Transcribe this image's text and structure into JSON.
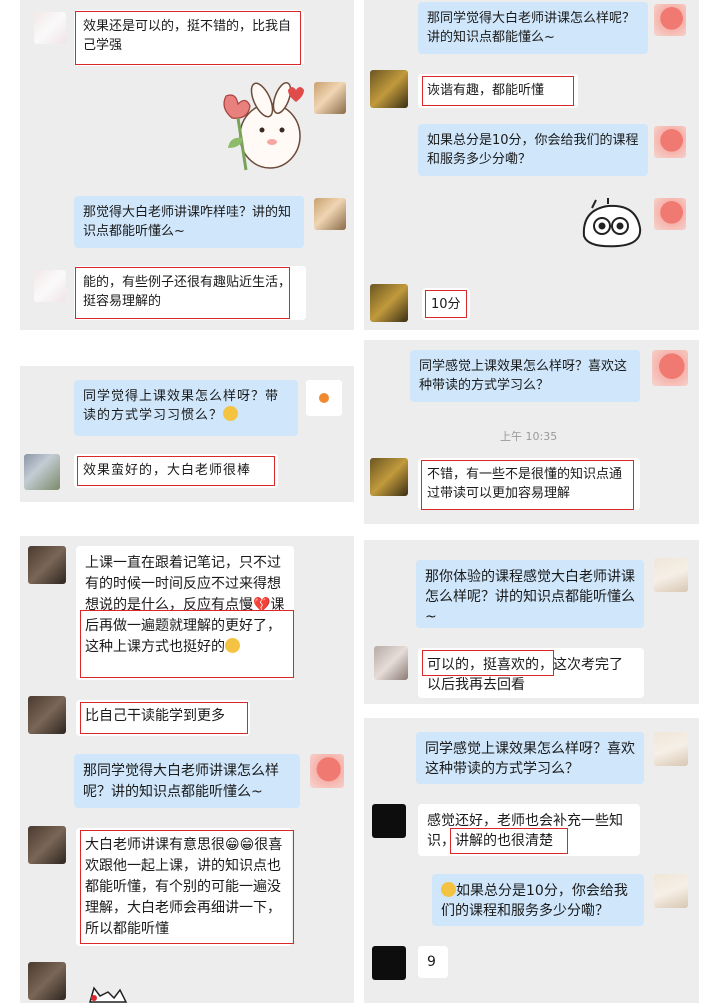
{
  "panel1": {
    "msg1": "效果还是可以的，挺不错的，比我自己学强",
    "msg2": "那觉得大白老师讲课咋样哇？讲的知识点都能听懂么~",
    "msg3": "能的，有些例子还很有趣贴近生活，挺容易理解的"
  },
  "panel2": {
    "msg1": "那同学觉得大白老师讲课怎么样呢？讲的知识点都能懂么~",
    "msg2": "诙谐有趣，都能听懂",
    "msg3": "如果总分是10分，你会给我们的课程和服务多少分嘞？",
    "msg4": "10分"
  },
  "panel3": {
    "msg1": "同学觉得上课效果怎么样呀？带读的方式学习习惯么？",
    "msg2": "效果蛮好的，大白老师很棒"
  },
  "panel4": {
    "msg1": "同学感觉上课效果怎么样呀？喜欢这种带读的方式学习么？",
    "time": "上午 10:35",
    "msg2": "不错，有一些不是很懂的知识点通过带读可以更加容易理解"
  },
  "panel5": {
    "msg1": "上课一直在跟着记笔记，只不过有的时候一时间反应不过来得想想说的是什么，反应有点慢💔课后再做一遍题就理解的更好了，这种上课方式也挺好的",
    "msg2": "比自己干读能学到更多",
    "msg3": "那同学觉得大白老师讲课怎么样呢？讲的知识点都能听懂么~",
    "msg4": "大白老师讲课有意思很😁😁很喜欢跟他一起上课，讲的知识点也都能听懂，有个别的可能一遍没理解，大白老师会再细讲一下，所以都能听懂"
  },
  "panel6": {
    "msg1": "那你体验的课程感觉大白老师讲课怎么样呢？讲的知识点都能听懂么~",
    "msg2": "可以的，挺喜欢的，这次考完了以后我再去回看"
  },
  "panel7": {
    "msg1": "同学感觉上课效果怎么样呀？喜欢这种带读的方式学习么？",
    "msg2": "感觉还好，老师也会补充一些知识，讲解的也很清楚",
    "msg3": "如果总分是10分，你会给我们的课程和服务多少分嘞？",
    "msg4": "9"
  }
}
